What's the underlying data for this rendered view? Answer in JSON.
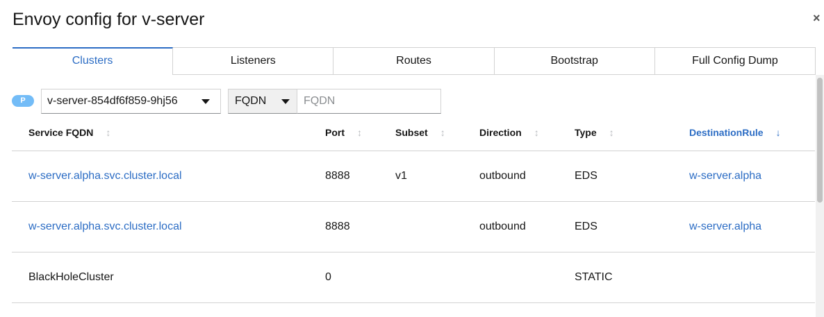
{
  "modal": {
    "title": "Envoy config for v-server",
    "close_label": "×"
  },
  "tabs": [
    {
      "label": "Clusters",
      "active": true
    },
    {
      "label": "Listeners",
      "active": false
    },
    {
      "label": "Routes",
      "active": false
    },
    {
      "label": "Bootstrap",
      "active": false
    },
    {
      "label": "Full Config Dump",
      "active": false
    }
  ],
  "toolbar": {
    "pod_badge": "P",
    "pod_selected": "v-server-854df6f859-9hj56",
    "filter_type": "FQDN",
    "filter_placeholder": "FQDN",
    "filter_value": ""
  },
  "table": {
    "columns": [
      {
        "label": "Service FQDN",
        "sort_icon": "↕"
      },
      {
        "label": "Port",
        "sort_icon": "↕"
      },
      {
        "label": "Subset",
        "sort_icon": "↕"
      },
      {
        "label": "Direction",
        "sort_icon": "↕"
      },
      {
        "label": "Type",
        "sort_icon": "↕"
      },
      {
        "label": "DestinationRule",
        "sort_icon": "↓"
      }
    ],
    "rows": [
      {
        "fqdn": "w-server.alpha.svc.cluster.local",
        "port": "8888",
        "subset": "v1",
        "direction": "outbound",
        "type": "EDS",
        "destination_rule": "w-server.alpha"
      },
      {
        "fqdn": "w-server.alpha.svc.cluster.local",
        "port": "8888",
        "subset": "",
        "direction": "outbound",
        "type": "EDS",
        "destination_rule": "w-server.alpha"
      },
      {
        "fqdn": "BlackHoleCluster",
        "port": "0",
        "subset": "",
        "direction": "",
        "type": "STATIC",
        "destination_rule": ""
      }
    ]
  },
  "colors": {
    "accent": "#2b6cc4",
    "badge": "#73bcf7",
    "border": "#d2d2d2"
  }
}
